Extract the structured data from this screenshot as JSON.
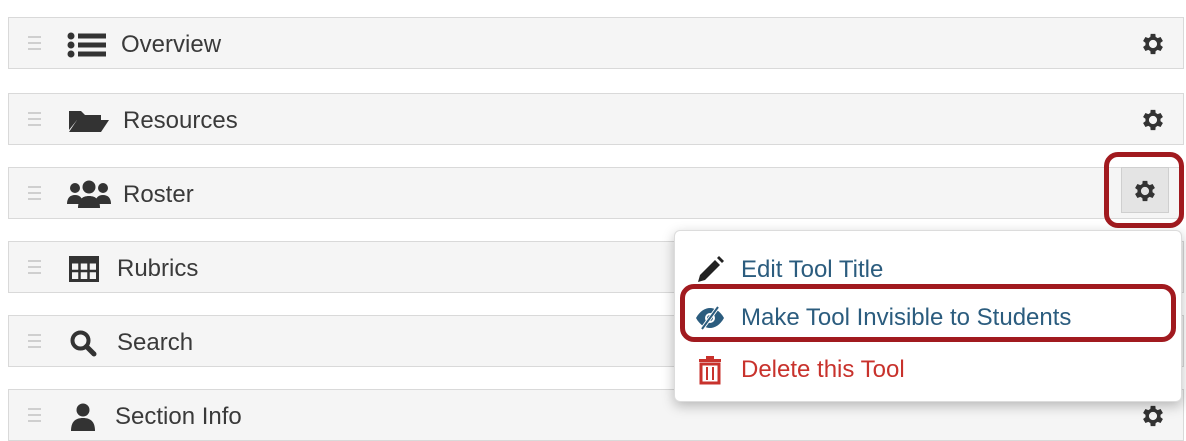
{
  "tools": [
    {
      "label": "Overview",
      "icon": "list-icon"
    },
    {
      "label": "Resources",
      "icon": "folder-open-icon"
    },
    {
      "label": "Roster",
      "icon": "users-icon"
    },
    {
      "label": "Rubrics",
      "icon": "table-icon"
    },
    {
      "label": "Search",
      "icon": "search-icon"
    },
    {
      "label": "Section Info",
      "icon": "user-icon"
    }
  ],
  "menu": {
    "edit_title": "Edit Tool Title",
    "make_invisible": "Make Tool Invisible to Students",
    "delete_tool": "Delete this Tool"
  },
  "colors": {
    "link": "#2b5c7e",
    "danger": "#c8322c",
    "highlight": "#a11a1f",
    "icon": "#333333"
  }
}
